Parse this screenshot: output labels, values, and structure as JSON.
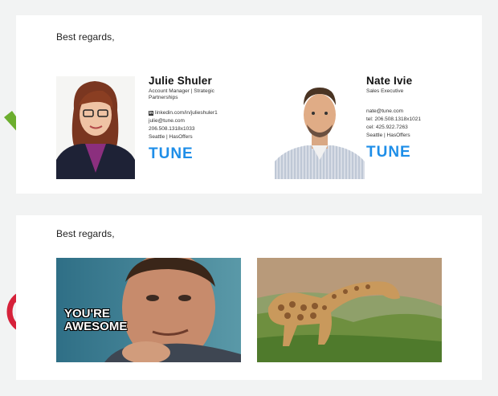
{
  "good_example": {
    "greeting": "Best regards,",
    "signatures": [
      {
        "name": "Julie Shuler",
        "title": "Account Manager | Strategic Partnerships",
        "linkedin": "linkedin.com/in/julieshuler1",
        "email": "julie@tune.com",
        "phone": "206.508.1318x1033",
        "location": "Seattle  |  HasOffers",
        "logo": "TUNE"
      },
      {
        "name": "Nate Ivie",
        "title": "Sales Executive",
        "email": "nate@tune.com",
        "tel": "tel: 206.508.1318x1021",
        "cel": "cel: 425.922.7263",
        "location": "Seattle  |  HasOffers",
        "logo": "TUNE"
      }
    ],
    "indicator_icon": "checkmark-icon",
    "indicator_color": "#6cae2e"
  },
  "bad_example": {
    "greeting": "Best regards,",
    "meme_caption": "YOU'RE\nAWESOME",
    "indicator_icon": "prohibited-icon",
    "indicator_color": "#d6223a"
  },
  "brand_color": "#1e8ee8"
}
